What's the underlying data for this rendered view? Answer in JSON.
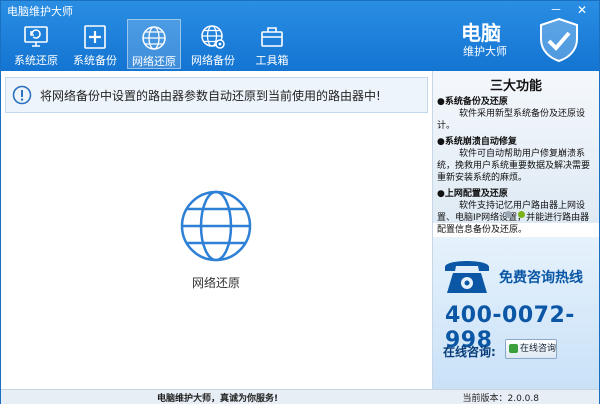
{
  "window": {
    "title": "电脑维护大师",
    "min_label": "－",
    "close_label": "✕"
  },
  "toolbar": [
    {
      "label": "系统还原",
      "icon": "restore-icon"
    },
    {
      "label": "系统备份",
      "icon": "backup-icon"
    },
    {
      "label": "网络还原",
      "icon": "globe-icon",
      "active": true
    },
    {
      "label": "网络备份",
      "icon": "globe-gear-icon"
    },
    {
      "label": "工具箱",
      "icon": "toolbox-icon"
    }
  ],
  "brand": {
    "name": "电脑",
    "subtitle": "维护大师"
  },
  "alert": {
    "text": "将网络备份中设置的路由器参数自动还原到当前使用的路由器中!"
  },
  "center": {
    "label": "网络还原"
  },
  "features": {
    "title": "三大功能",
    "items": [
      {
        "head": "系统备份及还原",
        "desc": "软件采用新型系统备份及还原设计。"
      },
      {
        "head": "系统崩溃自动修复",
        "desc": "软件可自动帮助用户修复崩溃系统，挽救用户系统重要数据及解决需要重新安装系统的麻烦。"
      },
      {
        "head": "上网配置及还原",
        "desc": "软件支持记忆用户路由器上网设置、电脑IP网络设置，并能进行路由器配置信息备份及还原。"
      }
    ]
  },
  "hotline": {
    "free_label": "免费咨询热线",
    "number": "400-0072-998",
    "online_label": "在线咨询:",
    "online_button": "在线咨询"
  },
  "status": {
    "center_text": "电脑维护大师，真诚为你服务!",
    "version": "当前版本：2.0.0.8"
  },
  "colors": {
    "accent": "#1474d2",
    "brand_blue": "#0b57a5",
    "dot_active": "#7ab317",
    "dot_inactive": "#9aa7b3"
  }
}
